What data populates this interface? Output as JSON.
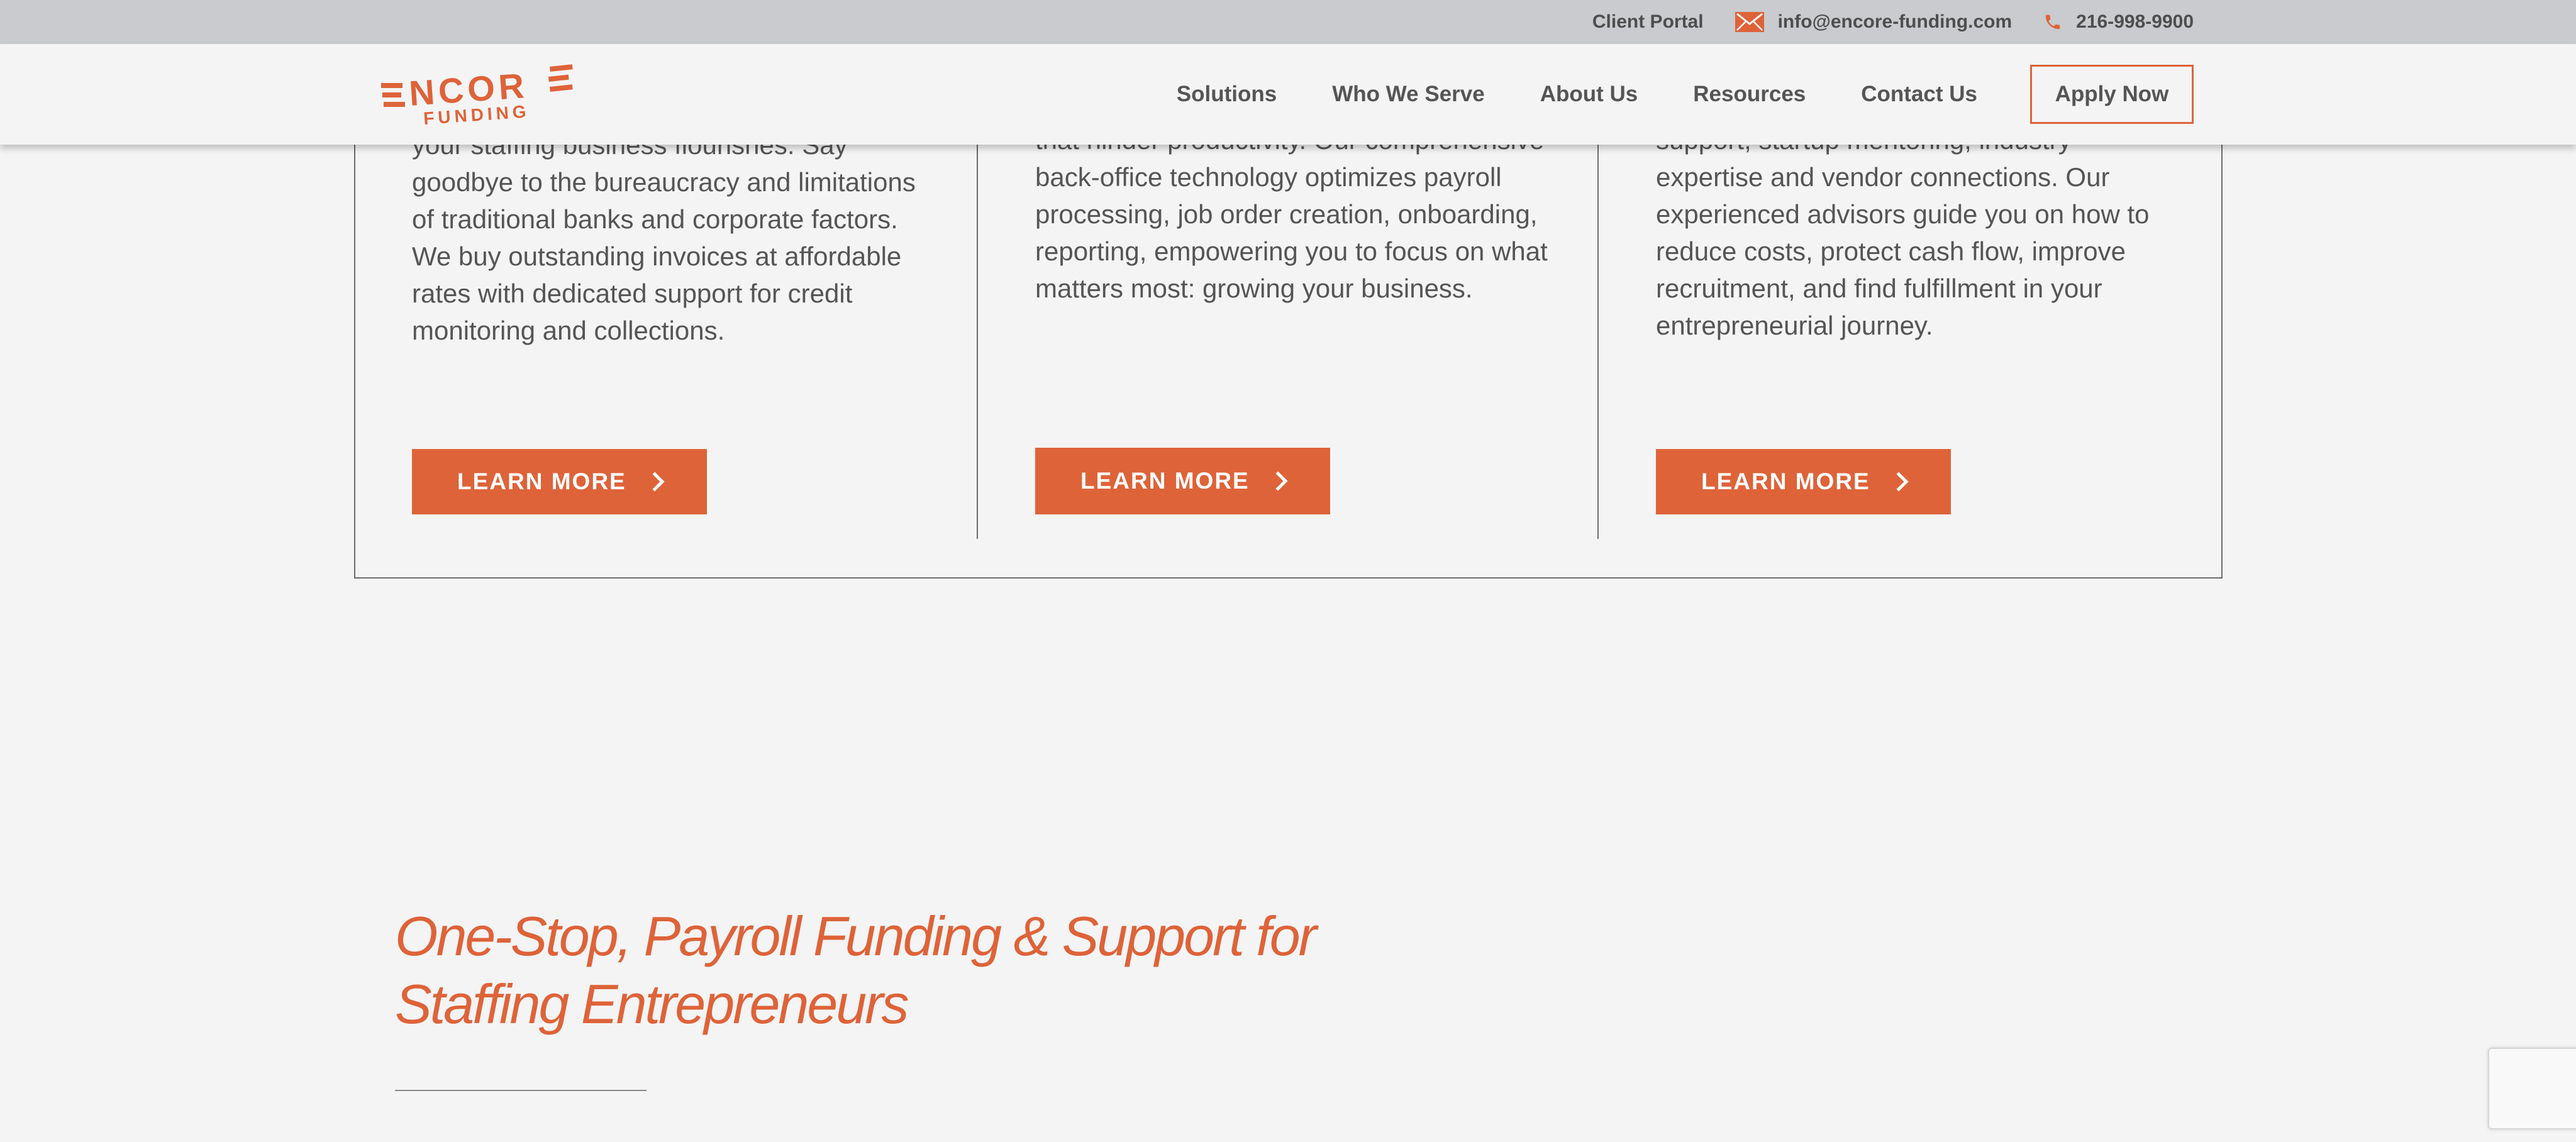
{
  "topbar": {
    "client_portal": "Client Portal",
    "email": "info@encore-funding.com",
    "phone": "216-998-9900"
  },
  "header": {
    "logo_top": "ENCORE",
    "logo_bottom": "FUNDING",
    "nav": [
      "Solutions",
      "Who We Serve",
      "About Us",
      "Resources",
      "Contact Us"
    ],
    "apply_label": "Apply Now"
  },
  "columns": [
    {
      "text": "your staffing business flourishes. Say goodbye to the bureaucracy and limitations of traditional banks and corporate factors. We buy outstanding invoices at affordable rates with dedicated support for credit monitoring and collections.",
      "button": "LEARN MORE"
    },
    {
      "text": "that hinder productivity. Our comprehensive back-office technology optimizes payroll processing, job order creation, onboarding, reporting, empowering you to focus on what matters most: growing your business.",
      "button": "LEARN MORE"
    },
    {
      "text": "support, startup mentoring, industry expertise and vendor connections. Our experienced advisors guide you on how to reduce costs, protect cash flow, improve recruitment, and find fulfillment in your entrepreneurial journey.",
      "button": "LEARN MORE"
    }
  ],
  "section": {
    "headline": "One-Stop, Payroll Funding & Support for Staffing Entrepreneurs"
  },
  "colors": {
    "accent": "#de6339",
    "topbar_bg": "#c9cbce",
    "page_bg": "#f4f4f4",
    "text": "#555555"
  },
  "icons": {
    "email": "envelope-icon",
    "phone": "phone-icon",
    "chevron": "chevron-right-icon"
  }
}
